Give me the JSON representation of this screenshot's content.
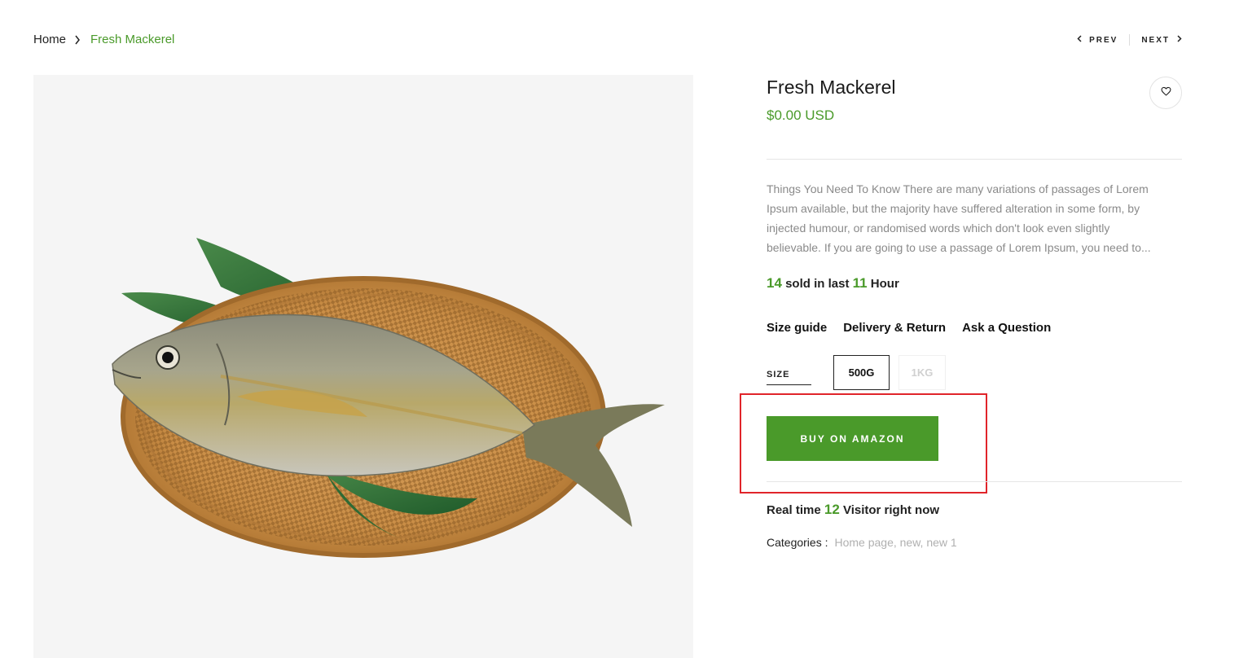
{
  "breadcrumb": {
    "home": "Home",
    "current": "Fresh Mackerel"
  },
  "pager": {
    "prev": "PREV",
    "next": "NEXT"
  },
  "product": {
    "title": "Fresh Mackerel",
    "price": "$0.00 USD",
    "description": "Things You Need To Know There are many variations of passages of Lorem Ipsum available, but the majority have suffered alteration in some form, by injected humour, or randomised words which don't look even slightly believable. If you are going to use a passage of Lorem Ipsum, you need to...",
    "sold": {
      "count": "14",
      "text_mid": "sold in last",
      "hours": "11",
      "text_end": "Hour"
    },
    "links": [
      "Size guide",
      "Delivery & Return",
      "Ask a Question"
    ],
    "size_label": "SIZE",
    "sizes": [
      {
        "label": "500G",
        "state": "selected"
      },
      {
        "label": "1KG",
        "state": "unavailable"
      }
    ],
    "buy_label": "BUY ON AMAZON",
    "visitors": {
      "prefix": "Real time",
      "count": "12",
      "suffix": "Visitor right now"
    },
    "categories_label": "Categories :",
    "categories_values": "Home page, new, new 1"
  },
  "colors": {
    "accent": "#4a9a2a",
    "highlight": "#e0242a",
    "muted_text": "#8a8a8a"
  },
  "icons": {
    "breadcrumb_separator": "chevron-right-icon",
    "prev": "chevron-left-icon",
    "next": "chevron-right-icon",
    "wishlist": "heart-icon"
  }
}
